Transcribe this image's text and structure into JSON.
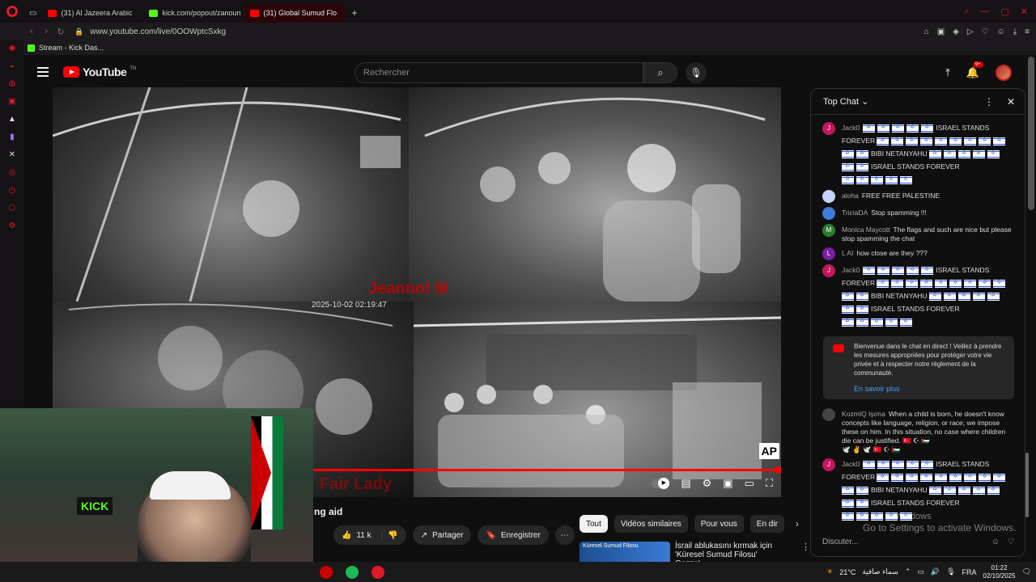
{
  "browser": {
    "tabs": [
      {
        "label": "(31) Al Jazeera Arabic",
        "icon": "youtube-icon",
        "color": "#ff0000",
        "active": false
      },
      {
        "label": "kick.com/popout/zanoun",
        "icon": "kick-icon",
        "color": "#53fc18",
        "active": false
      },
      {
        "label": "(31) Global Sumud Flo",
        "icon": "youtube-icon",
        "color": "#ff0000",
        "active": true
      }
    ],
    "new_tab": "+",
    "url": "www.youtube.com/live/0OOWptcSxkg",
    "bookmark": "Stream - Kick Das..."
  },
  "youtube": {
    "logo": "YouTube",
    "logo_suffix": "TN",
    "search_placeholder": "Rechercher",
    "notification_count": "9+"
  },
  "video": {
    "overlay_top": "Jeannot III",
    "timestamp": "2025-10-02 02:19:47",
    "overlay_bottom": "Fair Lady",
    "watermark": "AP",
    "progress": 0.995,
    "title_partial": "ng aid",
    "likes": "11 k",
    "share": "Partager",
    "save": "Enregistrer"
  },
  "webcam": {
    "sign": "KICK"
  },
  "chips": [
    "Tout",
    "Vidéos similaires",
    "Pour vous",
    "En dir"
  ],
  "recommended": {
    "thumb_text": "Küresel Sumud Filosu",
    "title": "İsrail ablukasını kırmak için 'Küresel Sumud Filosu' Gazze'"
  },
  "chat": {
    "header": "Top Chat",
    "messages": [
      {
        "author": "Jack0",
        "avatar_letter": "J",
        "avatar_color": "#c2185b",
        "lines": [
          [
            "flags5",
            "ISRAEL STANDS"
          ],
          [
            "FOREVER",
            "flags9"
          ],
          [
            "flags2",
            "BIBI NETANYAHU",
            "flags5"
          ],
          [
            "flags2",
            "ISRAEL STANDS FOREVER"
          ],
          [
            "flags5"
          ]
        ]
      },
      {
        "author": "aloha",
        "avatar_letter": "",
        "avatar_color": "#c8d2ff",
        "text": "FREE FREE PALESTINE"
      },
      {
        "author": "TriciaDA",
        "avatar_letter": "",
        "avatar_color": "#3c7dd9",
        "text": "Stop spamming !!!"
      },
      {
        "author": "Monica Maycott",
        "avatar_letter": "M",
        "avatar_color": "#2e7d32",
        "text": "The flags and such are nice but please stop spamming the chat"
      },
      {
        "author": "L AI",
        "avatar_letter": "L",
        "avatar_color": "#7b1fa2",
        "text": "how close are they ???"
      },
      {
        "author": "Jack0",
        "avatar_letter": "J",
        "avatar_color": "#c2185b",
        "lines": [
          [
            "flags5",
            "ISRAEL STANDS"
          ],
          [
            "FOREVER",
            "flags9"
          ],
          [
            "flags2",
            "BIBI NETANYAHU",
            "flags5"
          ],
          [
            "flags2",
            "ISRAEL STANDS FOREVER"
          ],
          [
            "flags5"
          ]
        ]
      }
    ],
    "notice": "Bienvenue dans le chat en direct ! Veillez à prendre les mesures appropriées pour protéger votre vie privée et à respecter notre règlement de la communauté.",
    "notice_link": "En savoir plus",
    "late_messages": [
      {
        "author": "KozmIQ Işıma",
        "avatar_letter": "",
        "avatar_color": "#444",
        "text": "When a child is born, he doesn't know concepts like language, religion, or race; we impose these on him. In this situation, no case where children die can be justified.",
        "emoji": "🇹🇷 ☪ 🇵🇸",
        "emoji_line": "🕊️ ✌️ 🕊️ 🇹🇷 ☪ 🇵🇸"
      },
      {
        "author": "Jack0",
        "avatar_letter": "J",
        "avatar_color": "#c2185b",
        "lines": [
          [
            "flags5",
            "ISRAEL STANDS"
          ],
          [
            "FOREVER",
            "flags9"
          ],
          [
            "flags2",
            "BIBI NETANYAHU",
            "flags5"
          ],
          [
            "flags2",
            "ISRAEL STANDS FOREVER"
          ],
          [
            "flags5"
          ]
        ]
      }
    ],
    "input_placeholder": "Discuter..."
  },
  "windows": {
    "activate_title": "Windows",
    "activate_text": "Go to Settings to activate Windows."
  },
  "taskbar": {
    "temperature": "21°C",
    "weather": "سماء صافية",
    "language": "FRA",
    "time": "01:22",
    "date": "02/10/2025"
  }
}
